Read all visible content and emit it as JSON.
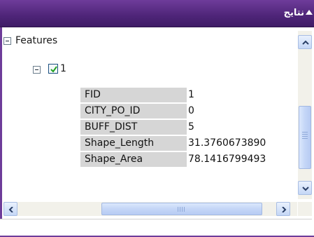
{
  "panel": {
    "title": "نتايج"
  },
  "tree": {
    "root_label": "Features",
    "feature_label": "1",
    "feature_checked": true,
    "attributes": [
      {
        "key": "FID",
        "value": "1"
      },
      {
        "key": "CITY_PO_ID",
        "value": "0"
      },
      {
        "key": "BUFF_DIST",
        "value": "5"
      },
      {
        "key": "Shape_Length",
        "value": "31.3760673890"
      },
      {
        "key": "Shape_Area",
        "value": "78.1416799493"
      }
    ]
  },
  "colors": {
    "titlebar": "#4e2578",
    "attr_key_bg": "#d6d6d6",
    "scroll_thumb": "#c4d6f7"
  }
}
